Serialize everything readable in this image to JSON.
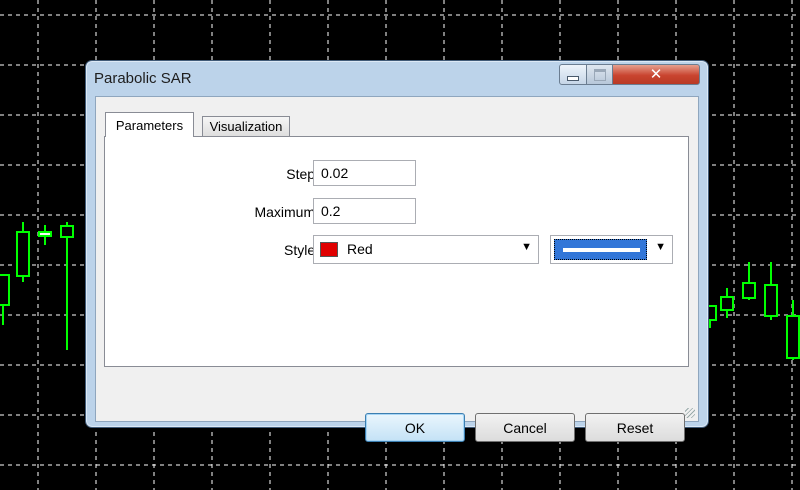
{
  "dialog": {
    "title": "Parabolic SAR",
    "tabs": [
      {
        "label": "Parameters",
        "active": true
      },
      {
        "label": "Visualization",
        "active": false
      }
    ],
    "fields": {
      "step": {
        "label": "Step:",
        "value": "0.02"
      },
      "maximum": {
        "label": "Maximum:",
        "value": "0.2"
      },
      "style": {
        "label": "Style:",
        "color_name": "Red",
        "color_hex": "#e00000",
        "line_color_hex": "#3276d8"
      }
    },
    "buttons": {
      "ok": "OK",
      "cancel": "Cancel",
      "reset": "Reset"
    },
    "title_buttons": [
      "minimize-icon",
      "maximize-icon",
      "close-icon"
    ]
  },
  "colors": {
    "background": "#000000",
    "grid": "#ffffff",
    "candle_up": "#00ff00",
    "dialog_frame": "#bcd3ea"
  }
}
